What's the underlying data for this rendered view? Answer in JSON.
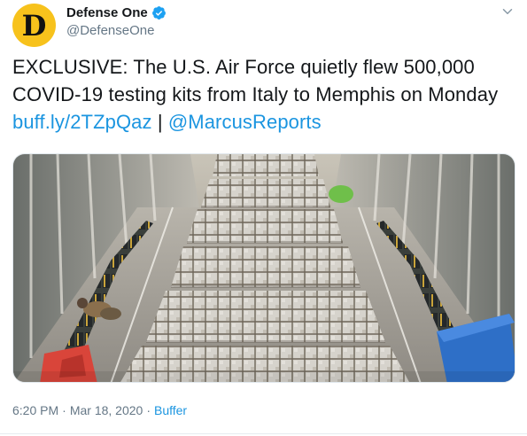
{
  "author": {
    "avatar_letter": "D",
    "display_name": "Defense One",
    "handle": "@DefenseOne",
    "verified": true,
    "avatar_color": "#f7c21c"
  },
  "tweet": {
    "text_main": "EXCLUSIVE: The U.S. Air Force quietly flew 500,000 COVID-19 testing kits from Italy to Memphis on Monday ",
    "link_short": "buff.ly/2TZpQaz",
    "separator": " | ",
    "mention": "@MarcusReports"
  },
  "meta": {
    "time": "6:20 PM",
    "dot1": "·",
    "date": "Mar 18, 2020",
    "dot2": "·",
    "source": "Buffer"
  },
  "colors": {
    "link": "#1b95e0",
    "verified_badge": "#1da1f2",
    "secondary_text": "#657786"
  },
  "icons": {
    "verified": "verified-badge-icon",
    "more": "chevron-down-icon"
  }
}
